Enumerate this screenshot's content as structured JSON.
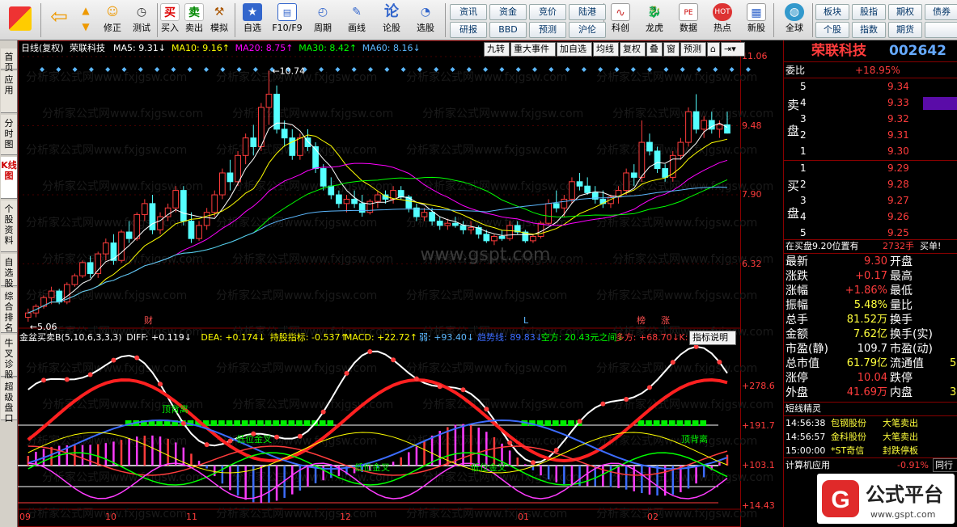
{
  "toolbar": {
    "items": [
      {
        "id": "back",
        "label": "",
        "icon": "back-arrow-icon"
      },
      {
        "id": "updown",
        "label": "修正",
        "icon": "smile-icon"
      },
      {
        "id": "test",
        "label": "测试",
        "icon": "clock-icon"
      },
      {
        "id": "buy",
        "label": "买入",
        "glyph": "买"
      },
      {
        "id": "sell",
        "label": "卖出",
        "glyph": "卖"
      },
      {
        "id": "sim",
        "label": "模拟",
        "icon": "hammer-icon"
      },
      {
        "id": "selfsel",
        "label": "自选",
        "icon": "star-icon"
      },
      {
        "id": "f10",
        "label": "F10/F9",
        "icon": "f10-icon"
      },
      {
        "id": "period",
        "label": "周期",
        "icon": "clock-icon"
      },
      {
        "id": "draw",
        "label": "画线",
        "icon": "pencil-icon"
      },
      {
        "id": "forum",
        "label": "论股",
        "glyph": "论"
      },
      {
        "id": "pick",
        "label": "选股",
        "icon": "gauge-icon"
      },
      {
        "id": "kechuang",
        "label": "科创",
        "icon": "chart-icon"
      },
      {
        "id": "longhu",
        "label": "龙虎",
        "icon": "dragon-icon"
      },
      {
        "id": "data",
        "label": "数据",
        "icon": "pe-icon"
      },
      {
        "id": "hot",
        "label": "热点",
        "icon": "hot-icon"
      },
      {
        "id": "newstock",
        "label": "新股",
        "icon": "newstock-icon"
      },
      {
        "id": "global",
        "label": "全球",
        "icon": "globe-icon"
      }
    ],
    "small": [
      [
        "资讯",
        "资金",
        "竞价",
        "陆港"
      ],
      [
        "研报",
        "BBD",
        "预测",
        "沪伦"
      ]
    ],
    "small2": [
      [
        "板块",
        "股指",
        "期权",
        "债券"
      ],
      [
        "个股",
        "指数",
        "期货",
        ""
      ]
    ]
  },
  "tabs": [
    "首页",
    "应用",
    "分时图",
    "K线图",
    "个股资料",
    "自选股",
    "综合排名",
    "牛叉诊股",
    "超级盘口"
  ],
  "chart": {
    "title": "日线(复权)",
    "stock": "荣联科技",
    "ma": [
      {
        "k": "MA5: 9.31↓",
        "c": "#ffffff"
      },
      {
        "k": "MA10: 9.16↑",
        "c": "#ffff00"
      },
      {
        "k": "MA20: 8.75↑",
        "c": "#ff00ff"
      },
      {
        "k": "MA30: 8.42↑",
        "c": "#00ff00"
      },
      {
        "k": "MA60: 8.16↓",
        "c": "#5cb8ff"
      }
    ],
    "buttons": [
      "九转",
      "重大事件",
      "加自选",
      "均线",
      "复权",
      "叠",
      "窗",
      "预测"
    ],
    "price_labels": [
      "11.06",
      "9.48",
      "7.90",
      "6.32"
    ],
    "high_mark": "10.74",
    "low_mark": "5.06",
    "markers": [
      "财",
      "L",
      "榜",
      "涨"
    ],
    "indicator": [
      {
        "k": "金盆买卖B(5,10,6,3,3,3)",
        "c": "#ffffff"
      },
      {
        "k": "DIFF: +0.119↓",
        "c": "#ffffff"
      },
      {
        "k": "DEA: +0.174↓",
        "c": "#ffff00"
      },
      {
        "k": "持股指标: -0.537↑",
        "c": "#ffff00"
      },
      {
        "k": "MACD: +22.72↑",
        "c": "#ffff00"
      },
      {
        "k": "弱: +93.40↓",
        "c": "#5cb8ff"
      },
      {
        "k": "趋势线: 89.83↓",
        "c": "#3c6cff"
      },
      {
        "k": "空方: 20.43元之间↓",
        "c": "#00ff00"
      },
      {
        "k": "多方: +68.70↓",
        "c": "#ff3c3c"
      },
      {
        "k": "K:",
        "c": "#ff3c3c"
      }
    ],
    "ind_btn": "指标说明",
    "ind_labels": [
      "+278.6",
      "+191.7",
      "+103.1",
      "+14.43"
    ],
    "ind_texts": [
      "顶背离",
      "低位金叉",
      "低位金叉",
      "低位金叉",
      "顶背离"
    ],
    "dates": [
      "09",
      "10",
      "11",
      "12",
      "01",
      "02"
    ],
    "watermark": "www.gspt.com",
    "watermark2": "分析家公式网www.fxjgsw.com"
  },
  "chart_data": {
    "type": "candlestick",
    "candles": [
      [
        5.1,
        5.3,
        5.0,
        5.2
      ],
      [
        5.2,
        5.4,
        5.1,
        5.35
      ],
      [
        5.35,
        5.6,
        5.3,
        5.55
      ],
      [
        5.55,
        5.8,
        5.4,
        5.7
      ],
      [
        5.7,
        5.75,
        5.4,
        5.45
      ],
      [
        5.45,
        5.9,
        5.4,
        5.85
      ],
      [
        5.85,
        6.1,
        5.8,
        6.05
      ],
      [
        6.05,
        6.4,
        6.0,
        6.35
      ],
      [
        6.35,
        6.5,
        6.0,
        6.1
      ],
      [
        6.1,
        6.6,
        6.0,
        6.55
      ],
      [
        6.55,
        6.9,
        6.4,
        6.8
      ],
      [
        6.8,
        7.0,
        6.3,
        6.4
      ],
      [
        6.4,
        7.1,
        6.35,
        7.05
      ],
      [
        7.05,
        7.3,
        6.8,
        6.9
      ],
      [
        6.9,
        7.5,
        6.85,
        7.45
      ],
      [
        7.45,
        7.8,
        7.3,
        7.7
      ],
      [
        7.7,
        7.9,
        7.0,
        7.1
      ],
      [
        7.1,
        7.5,
        7.0,
        7.4
      ],
      [
        7.4,
        7.7,
        7.3,
        7.6
      ],
      [
        7.6,
        8.1,
        7.5,
        8.0
      ],
      [
        8.0,
        8.1,
        7.2,
        7.3
      ],
      [
        7.3,
        7.5,
        6.8,
        6.9
      ],
      [
        6.9,
        7.3,
        6.85,
        7.2
      ],
      [
        7.2,
        7.6,
        7.1,
        7.5
      ],
      [
        7.5,
        8.0,
        7.4,
        7.9
      ],
      [
        7.9,
        8.5,
        7.8,
        8.4
      ],
      [
        8.4,
        8.7,
        8.0,
        8.2
      ],
      [
        8.2,
        8.9,
        8.1,
        8.8
      ],
      [
        8.8,
        9.3,
        8.6,
        9.2
      ],
      [
        9.2,
        9.5,
        8.8,
        9.0
      ],
      [
        9.0,
        10.0,
        8.9,
        9.9
      ],
      [
        9.9,
        10.74,
        9.5,
        10.2
      ],
      [
        10.2,
        10.4,
        9.3,
        9.4
      ],
      [
        9.4,
        9.6,
        9.0,
        9.2
      ],
      [
        9.2,
        9.4,
        8.7,
        8.8
      ],
      [
        8.8,
        9.3,
        8.7,
        9.2
      ],
      [
        9.2,
        9.4,
        8.9,
        9.0
      ],
      [
        9.0,
        9.1,
        8.4,
        8.5
      ],
      [
        8.5,
        8.6,
        8.0,
        8.1
      ],
      [
        8.1,
        8.3,
        7.8,
        7.9
      ],
      [
        7.9,
        8.0,
        7.6,
        7.7
      ],
      [
        7.7,
        7.9,
        7.5,
        7.8
      ],
      [
        7.8,
        8.0,
        7.6,
        7.7
      ],
      [
        7.7,
        7.9,
        7.4,
        7.5
      ],
      [
        7.5,
        7.8,
        7.45,
        7.75
      ],
      [
        7.75,
        8.0,
        7.6,
        7.9
      ],
      [
        7.9,
        8.0,
        7.7,
        7.8
      ],
      [
        7.8,
        8.1,
        7.7,
        8.0
      ],
      [
        8.0,
        8.1,
        7.8,
        7.85
      ],
      [
        7.85,
        7.9,
        7.5,
        7.6
      ],
      [
        7.6,
        7.7,
        7.3,
        7.4
      ],
      [
        7.4,
        7.6,
        7.3,
        7.5
      ],
      [
        7.5,
        7.6,
        7.2,
        7.3
      ],
      [
        7.3,
        7.4,
        7.1,
        7.2
      ],
      [
        7.2,
        7.35,
        7.1,
        7.25
      ],
      [
        7.25,
        7.4,
        7.15,
        7.2
      ],
      [
        7.2,
        7.3,
        7.0,
        7.1
      ],
      [
        7.1,
        7.3,
        7.0,
        7.15
      ],
      [
        7.15,
        7.2,
        6.9,
        7.0
      ],
      [
        7.0,
        7.1,
        6.8,
        6.85
      ],
      [
        6.85,
        7.0,
        6.75,
        6.95
      ],
      [
        6.95,
        7.1,
        6.85,
        6.9
      ],
      [
        6.9,
        7.3,
        6.85,
        7.2
      ],
      [
        7.2,
        7.3,
        7.0,
        7.05
      ],
      [
        7.05,
        7.1,
        6.8,
        6.85
      ],
      [
        6.85,
        7.0,
        6.8,
        6.95
      ],
      [
        6.95,
        7.3,
        6.9,
        7.25
      ],
      [
        7.25,
        7.8,
        7.2,
        7.7
      ],
      [
        7.7,
        8.0,
        7.5,
        7.6
      ],
      [
        7.6,
        7.9,
        7.4,
        7.8
      ],
      [
        7.8,
        8.3,
        7.7,
        8.2
      ],
      [
        8.2,
        8.4,
        8.0,
        8.1
      ],
      [
        8.1,
        8.3,
        7.9,
        7.95
      ],
      [
        7.95,
        8.1,
        7.7,
        7.8
      ],
      [
        7.8,
        8.0,
        7.6,
        7.7
      ],
      [
        7.7,
        7.9,
        7.6,
        7.85
      ],
      [
        7.85,
        8.1,
        7.7,
        8.0
      ],
      [
        8.0,
        8.5,
        7.9,
        8.4
      ],
      [
        8.4,
        8.6,
        8.1,
        8.3
      ],
      [
        8.3,
        9.6,
        8.2,
        9.1
      ],
      [
        9.1,
        9.3,
        8.8,
        8.9
      ],
      [
        8.9,
        9.0,
        8.4,
        8.5
      ],
      [
        8.5,
        8.6,
        8.2,
        8.3
      ],
      [
        8.3,
        8.9,
        8.2,
        8.8
      ],
      [
        8.8,
        9.2,
        8.7,
        9.1
      ],
      [
        9.1,
        9.9,
        9.0,
        9.8
      ],
      [
        9.8,
        10.2,
        9.3,
        9.4
      ],
      [
        9.4,
        9.7,
        9.2,
        9.6
      ],
      [
        9.6,
        9.8,
        9.3,
        9.4
      ],
      [
        9.4,
        9.6,
        9.2,
        9.5
      ],
      [
        9.5,
        9.8,
        9.3,
        9.31
      ]
    ],
    "ylim": [
      5.0,
      11.06
    ]
  },
  "quote": {
    "name": "荣联科技",
    "code": "002642",
    "weibi_label": "委比",
    "weibi": "+18.95%",
    "sell_label": "卖盘",
    "buy_label": "买盘",
    "asks": [
      [
        "5",
        "9.34"
      ],
      [
        "4",
        "9.33"
      ],
      [
        "3",
        "9.32"
      ],
      [
        "2",
        "9.31"
      ],
      [
        "1",
        "9.30"
      ]
    ],
    "bids": [
      [
        "1",
        "9.29"
      ],
      [
        "2",
        "9.28"
      ],
      [
        "3",
        "9.27"
      ],
      [
        "4",
        "9.26"
      ],
      [
        "5",
        "9.25"
      ]
    ],
    "note": "在买盘9.20位置有",
    "note_v": "2732手",
    "note_b": "买单!",
    "rows": [
      [
        "最新",
        "9.30",
        "开盘",
        ""
      ],
      [
        "涨跌",
        "+0.17",
        "最高",
        ""
      ],
      [
        "涨幅",
        "+1.86%",
        "最低",
        ""
      ],
      [
        "振幅",
        "5.48%",
        "量比",
        ""
      ],
      [
        "总手",
        "81.52万",
        "换手",
        ""
      ],
      [
        "金额",
        "7.62亿",
        "换手(实)",
        ""
      ],
      [
        "市盈(静)",
        "109.7",
        "市盈(动)",
        ""
      ],
      [
        "总市值",
        "61.79亿",
        "流通值",
        "5"
      ],
      [
        "涨停",
        "10.04",
        "跌停",
        ""
      ],
      [
        "外盘",
        "41.69万",
        "内盘",
        "3"
      ]
    ],
    "sprite_title": "短线精灵",
    "sprites": [
      [
        "14:56:38",
        "包钢股份",
        "大笔卖出"
      ],
      [
        "14:56:57",
        "金科股份",
        "大笔卖出"
      ],
      [
        "15:00:00",
        "*ST奇信",
        "封跌停板"
      ]
    ],
    "app_label": "计算机应用",
    "app_v": "-0.91%",
    "app_btn": "同行",
    "brand": "公式平台",
    "brand_url": "www.gspt.com"
  }
}
